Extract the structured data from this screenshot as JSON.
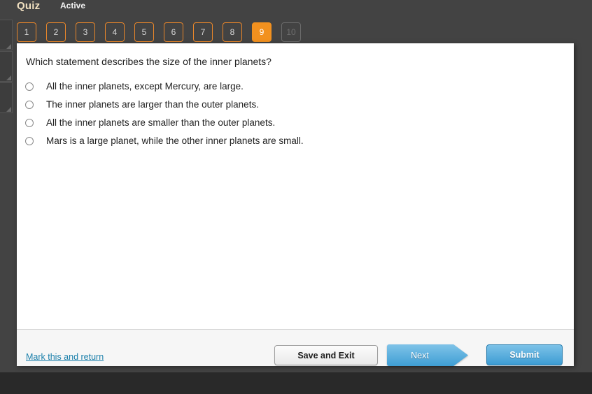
{
  "header": {
    "title": "Quiz",
    "status": "Active"
  },
  "question_nav": {
    "tabs": [
      {
        "label": "1",
        "state": "available"
      },
      {
        "label": "2",
        "state": "available"
      },
      {
        "label": "3",
        "state": "available"
      },
      {
        "label": "4",
        "state": "available"
      },
      {
        "label": "5",
        "state": "available"
      },
      {
        "label": "6",
        "state": "available"
      },
      {
        "label": "7",
        "state": "available"
      },
      {
        "label": "8",
        "state": "available"
      },
      {
        "label": "9",
        "state": "active"
      },
      {
        "label": "10",
        "state": "disabled"
      }
    ]
  },
  "question": {
    "text": "Which statement describes the size of the inner planets?",
    "selected_index": null,
    "options": [
      {
        "label": "All the inner planets, except Mercury, are large.",
        "selected": false
      },
      {
        "label": "The inner planets are larger than the outer planets.",
        "selected": false
      },
      {
        "label": "All the inner planets are smaller than the outer planets.",
        "selected": false
      },
      {
        "label": "Mars is a large planet, while the other inner planets are small.",
        "selected": false
      }
    ]
  },
  "footer": {
    "mark_link": "Mark this and return",
    "save_label": "Save and Exit",
    "next_label": "Next",
    "submit_label": "Submit"
  },
  "colors": {
    "page_background": "#434343",
    "bottom_band": "#292929",
    "accent_orange": "#f2911f",
    "tab_border_orange": "#e8862a",
    "title_cream": "#f0e0c0",
    "link_blue": "#1a7faa",
    "button_blue": "#3d9cd3",
    "card_white": "#ffffff",
    "footer_gray": "#f6f6f6"
  }
}
